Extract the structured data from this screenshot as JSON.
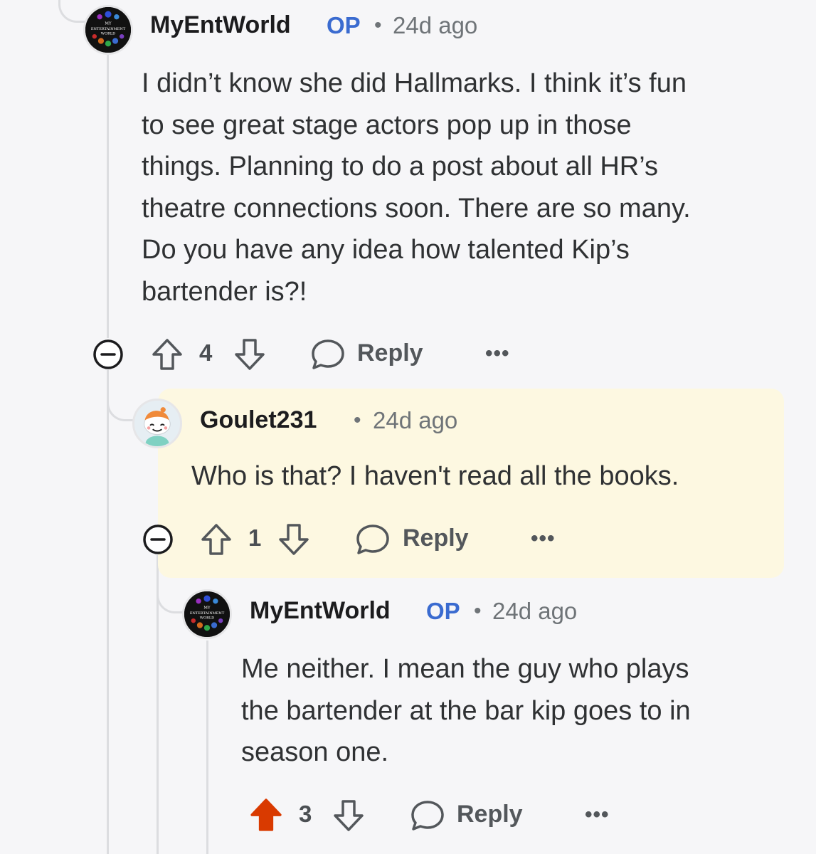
{
  "comments": [
    {
      "username": "MyEntWorld",
      "op_badge": "OP",
      "separator": "•",
      "time": "24d ago",
      "avatar_text": [
        "MY",
        "ENTERTAINMENT",
        "WORLD"
      ],
      "body": [
        "I didn’t know she did Hallmarks. I think it’s fun",
        "to see great stage actors pop up in those",
        "things. Planning to do a post about all HR’s",
        "theatre connections soon. There are so many.",
        "Do you have any idea how talented Kip’s",
        "bartender is?!"
      ],
      "score": "4",
      "reply_label": "Reply",
      "more_label": "•••",
      "upvoted": false
    },
    {
      "username": "Goulet231",
      "separator": "•",
      "time": "24d ago",
      "body": [
        "Who is that? I haven't read all the books."
      ],
      "score": "1",
      "reply_label": "Reply",
      "more_label": "•••",
      "highlighted": true,
      "upvoted": false
    },
    {
      "username": "MyEntWorld",
      "op_badge": "OP",
      "separator": "•",
      "time": "24d ago",
      "avatar_text": [
        "MY",
        "ENTERTAINMENT",
        "WORLD"
      ],
      "body": [
        "Me neither. I mean the guy who plays",
        "the bartender at the bar kip goes to in",
        "season one."
      ],
      "score": "3",
      "reply_label": "Reply",
      "more_label": "•••",
      "upvoted": true
    }
  ],
  "colors": {
    "background": "#f6f6f8",
    "highlight": "#fdf8e1",
    "op_badge": "#3a6bd0",
    "upvote_active": "#d93a00",
    "thread_line": "#dcdde0"
  },
  "icons": [
    "collapse-icon",
    "upvote-icon",
    "downvote-icon",
    "comment-bubble-icon",
    "more-options-icon"
  ]
}
